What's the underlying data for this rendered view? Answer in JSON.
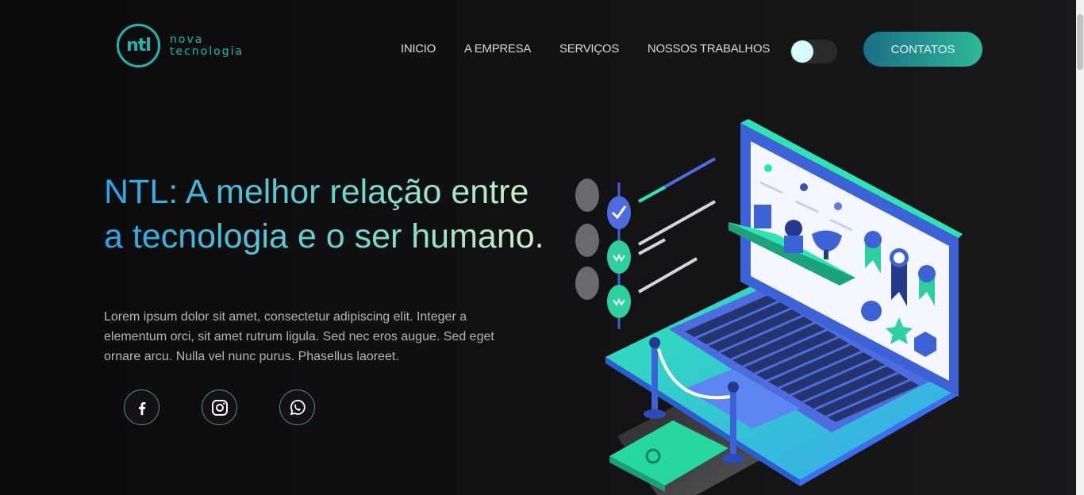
{
  "brand": {
    "mark": "ntl",
    "name_line1": "nova",
    "name_line2": "tecnologia"
  },
  "nav": {
    "items": [
      {
        "label": "INICIO"
      },
      {
        "label": "A EMPRESA"
      },
      {
        "label": "SERVIÇOS"
      },
      {
        "label": "NOSSOS TRABALHOS"
      }
    ],
    "theme_toggle_on": false,
    "cta_label": "CONTATOS"
  },
  "hero": {
    "title": "NTL: A melhor relação entre a tecnologia e o ser humano.",
    "text": "Lorem ipsum dolor sit amet, consectetur adipiscing elit. Integer a elementum orci, sit amet rutrum ligula. Sed nec eros augue. Sed eget ornare arcu. Nulla vel nunc purus. Phasellus laoreet."
  },
  "socials": [
    {
      "icon": "facebook-icon"
    },
    {
      "icon": "instagram-icon"
    },
    {
      "icon": "whatsapp-icon"
    }
  ],
  "colors": {
    "accent": "#1fb6b2",
    "cta_start": "#1a6f86",
    "cta_end": "#2eb89a",
    "title_start": "#2aa5e6",
    "title_end": "#d3f5c4"
  }
}
